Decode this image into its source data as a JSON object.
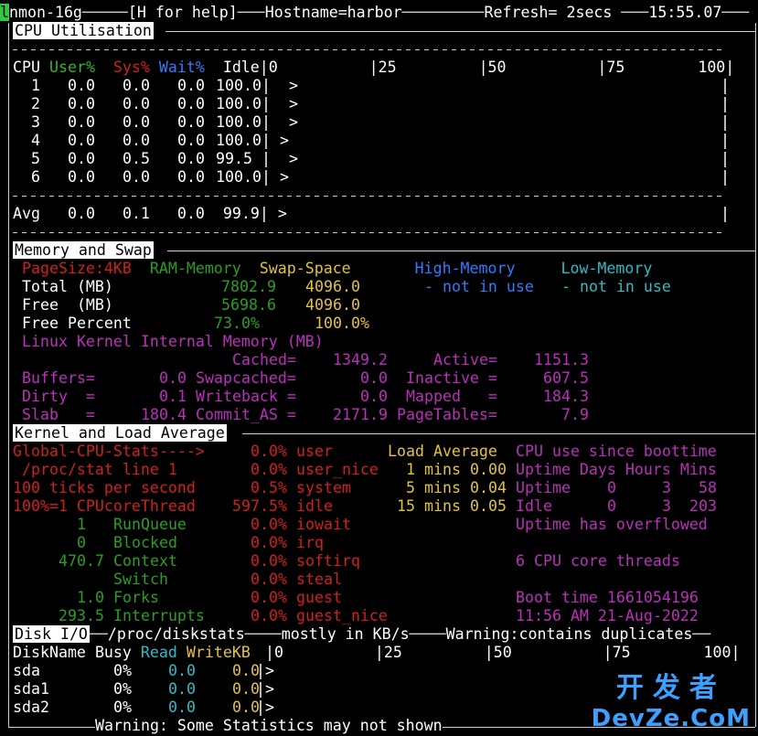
{
  "header": {
    "cursor_char": "l",
    "program": "nmon-16g",
    "help": "[H for help]",
    "hostname": "Hostname=harbor",
    "refresh": "Refresh= 2secs",
    "time": "15:55.07"
  },
  "cpu": {
    "tab_label": "CPU Utilisation",
    "header_cpu": "CPU",
    "header_user": "User%",
    "header_sys": "Sys%",
    "header_wait": "Wait%",
    "header_idle": "Idle",
    "scale": "|0          |25         |50          |75        100|",
    "rows": [
      {
        "id": "1",
        "user": "0.0",
        "sys": "0.0",
        "wait": "0.0",
        "idle": "100.0",
        "bar": "|  >"
      },
      {
        "id": "2",
        "user": "0.0",
        "sys": "0.0",
        "wait": "0.0",
        "idle": "100.0",
        "bar": "|  >"
      },
      {
        "id": "3",
        "user": "0.0",
        "sys": "0.0",
        "wait": "0.0",
        "idle": "100.0",
        "bar": "|  >"
      },
      {
        "id": "4",
        "user": "0.0",
        "sys": "0.0",
        "wait": "0.0",
        "idle": "100.0",
        "bar": "| >"
      },
      {
        "id": "5",
        "user": "0.0",
        "sys": "0.5",
        "wait": "0.0",
        "idle": "99.5",
        "bar": "|  >"
      },
      {
        "id": "6",
        "user": "0.0",
        "sys": "0.0",
        "wait": "0.0",
        "idle": "100.0",
        "bar": "| >"
      }
    ],
    "avg": {
      "id": "Avg",
      "user": "0.0",
      "sys": "0.1",
      "wait": "0.0",
      "idle": "99.9",
      "bar": "| >"
    }
  },
  "memory": {
    "tab_label": "Memory and Swap",
    "pagesize": "PageSize:4KB",
    "ram_header": "RAM-Memory",
    "swap_header": "Swap-Space",
    "high_header": "High-Memory",
    "low_header": "Low-Memory",
    "total_label": "Total (MB)",
    "total_ram": "7802.9",
    "total_swap": "4096.0",
    "high_note": "- not in use",
    "low_note": "- not in use",
    "free_label": "Free  (MB)",
    "free_ram": "5698.6",
    "free_swap": "4096.0",
    "freepct_label": "Free Percent",
    "freepct_ram": "73.0%",
    "freepct_swap": "100.0%",
    "kernel_title": "Linux Kernel Internal Memory (MB)",
    "cached_label": "Cached=",
    "cached": "1349.2",
    "active_label": "Active=",
    "active": "1151.3",
    "buffers_label": "Buffers=",
    "buffers": "0.0",
    "swapcached_label": "Swapcached=",
    "swapcached": "0.0",
    "inactive_label": "Inactive =",
    "inactive": "607.5",
    "dirty_label": "Dirty  =",
    "dirty": "0.1",
    "writeback_label": "Writeback =",
    "writeback": "0.0",
    "mapped_label": "Mapped   =",
    "mapped": "184.3",
    "slab_label": "Slab   =",
    "slab": "180.4",
    "commit_label": "Commit_AS =",
    "commit": "2171.9",
    "pagetables_label": "PageTables=",
    "pagetables": "7.9"
  },
  "kernel": {
    "tab_label": "Kernel and Load Average",
    "left": [
      "Global-CPU-Stats---->",
      " /proc/stat line 1",
      "100 ticks per second",
      "100%=1 CPUcoreThread"
    ],
    "runqueue_val": "1",
    "runqueue": "RunQueue",
    "blocked_val": "0",
    "blocked": "Blocked",
    "context_val": "470.7",
    "context": "Context",
    "switch": "Switch",
    "forks_val": "1.0",
    "forks": "Forks",
    "interrupts_val": "293.5",
    "interrupts": "Interrupts",
    "pcts": [
      {
        "val": "0.0%",
        "name": "user"
      },
      {
        "val": "0.0%",
        "name": "user_nice"
      },
      {
        "val": "0.5%",
        "name": "system"
      },
      {
        "val": "597.5%",
        "name": "idle"
      },
      {
        "val": "0.0%",
        "name": "iowait"
      },
      {
        "val": "0.0%",
        "name": "irq"
      },
      {
        "val": "0.0%",
        "name": "softirq"
      },
      {
        "val": "0.0%",
        "name": "steal"
      },
      {
        "val": "0.0%",
        "name": "guest"
      },
      {
        "val": "0.0%",
        "name": "guest_nice"
      }
    ],
    "load_title": "Load Average",
    "load": [
      {
        "n": "1",
        "unit": "mins",
        "val": "0.00"
      },
      {
        "n": "5",
        "unit": "mins",
        "val": "0.04"
      },
      {
        "n": "15",
        "unit": "mins",
        "val": "0.05"
      }
    ],
    "boot_title": "CPU use since boottime",
    "uptime_hdr": "Uptime Days Hours Mins",
    "uptime_row": {
      "label": "Uptime",
      "days": "0",
      "hours": "3",
      "mins": "58"
    },
    "idle_row": {
      "label": "Idle",
      "days": "0",
      "hours": "3",
      "mins": "203"
    },
    "overflow": "Uptime has overflowed",
    "threads": "6 CPU core threads",
    "boottime": "Boot time 1661054196",
    "bootdate": "11:56 AM 21-Aug-2022"
  },
  "disk": {
    "tab_label": "Disk I/O",
    "source": "/proc/diskstats",
    "units": "mostly in KB/s",
    "warning": "Warning:contains duplicates",
    "hdr_name": "DiskName",
    "hdr_busy": "Busy",
    "hdr_read": "Read",
    "hdr_write": "WriteKB",
    "scale": "|0          |25         |50          |75        100|",
    "rows": [
      {
        "name": "sda",
        "busy": "0%",
        "read": "0.0",
        "write": "0.0",
        "bar": "|>"
      },
      {
        "name": "sda1",
        "busy": "0%",
        "read": "0.0",
        "write": "0.0",
        "bar": "|>"
      },
      {
        "name": "sda2",
        "busy": "0%",
        "read": "0.0",
        "write": "0.0",
        "bar": "|>"
      }
    ]
  },
  "footer": {
    "warning": "Warning: Some Statistics may not shown"
  },
  "watermark": {
    "cn": "开发者",
    "en": "DevZe.CoM"
  },
  "colors": {
    "background": "#000000",
    "user": "#2fb81f",
    "sys": "#d11f1f",
    "wait": "#2f7bff",
    "swap": "#e3c33a",
    "kernel": "#bb2fbb",
    "disk_read": "#2dbcc8"
  }
}
